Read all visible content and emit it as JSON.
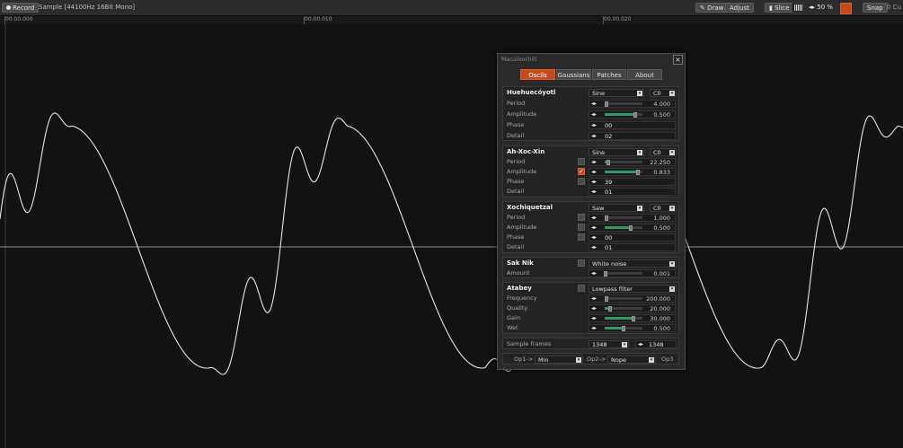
{
  "toolbar": {
    "record_label": "Record",
    "sample_info": "Sample [44100Hz 16Bit Mono]",
    "draw_label": "Draw",
    "adjust_label": "Adjust",
    "slice_label": "Slice",
    "zoom_value": "50 %",
    "snap_label": "Snap",
    "cursor_label": "0 Cu",
    "accent_color": "#c4491c"
  },
  "ruler": {
    "ticks": [
      "00.00.000",
      "00.00.010",
      "00.00.020"
    ]
  },
  "panel": {
    "title": "Macuilxochitl",
    "close_icon": "close-icon",
    "tabs": [
      {
        "label": "Oscils",
        "active": true
      },
      {
        "label": "Gaussians",
        "active": false
      },
      {
        "label": "Patches",
        "active": false
      },
      {
        "label": "About",
        "active": false
      }
    ],
    "osc1": {
      "name": "Huehuecóyotl",
      "wave": "Sine",
      "note": "C0",
      "period": {
        "label": "Period",
        "value": "4.000",
        "level": 0.05
      },
      "amplitude": {
        "label": "Amplitude",
        "value": "0.500",
        "level": 0.8
      },
      "phase": {
        "label": "Phase",
        "value": "00"
      },
      "detail": {
        "label": "Detail",
        "value": "02"
      }
    },
    "osc2": {
      "name": "Ah-Xoc-Xin",
      "wave": "Sine",
      "note": "C0",
      "period": {
        "label": "Period",
        "value": "22.250",
        "level": 0.1
      },
      "amplitude": {
        "label": "Amplitude",
        "value": "0.833",
        "level": 0.88,
        "checked": true
      },
      "phase": {
        "label": "Phase",
        "value": "39"
      },
      "detail": {
        "label": "Detail",
        "value": "01"
      }
    },
    "osc3": {
      "name": "Xochiquetzal",
      "wave": "Saw",
      "note": "C0",
      "period": {
        "label": "Period",
        "value": "1.000",
        "level": 0.05
      },
      "amplitude": {
        "label": "Amplitude",
        "value": "0.500",
        "level": 0.7
      },
      "phase": {
        "label": "Phase",
        "value": "00"
      },
      "detail": {
        "label": "Detail",
        "value": "01"
      }
    },
    "noise": {
      "name": "Sak Nik",
      "type": "White noise",
      "amount": {
        "label": "Amount",
        "value": "0.001",
        "level": 0.02
      }
    },
    "filter": {
      "name": "Atabey",
      "type": "Lowpass filter",
      "frequency": {
        "label": "Frequency",
        "value": "200.000",
        "level": 0.05
      },
      "quality": {
        "label": "Quality",
        "value": "20.000",
        "level": 0.15
      },
      "gain": {
        "label": "Gain",
        "value": "30.000",
        "level": 0.75
      },
      "wet": {
        "label": "Wet",
        "value": "0.500",
        "level": 0.5
      }
    },
    "sample_frames": {
      "label": "Sample frames",
      "select_value": "1348",
      "value": "1348"
    },
    "ops": {
      "op1_label": "Op1->",
      "op1_value": "Min",
      "op2_label": "Op2->",
      "op2_value": "Nope",
      "op3_label": "Op3"
    }
  }
}
